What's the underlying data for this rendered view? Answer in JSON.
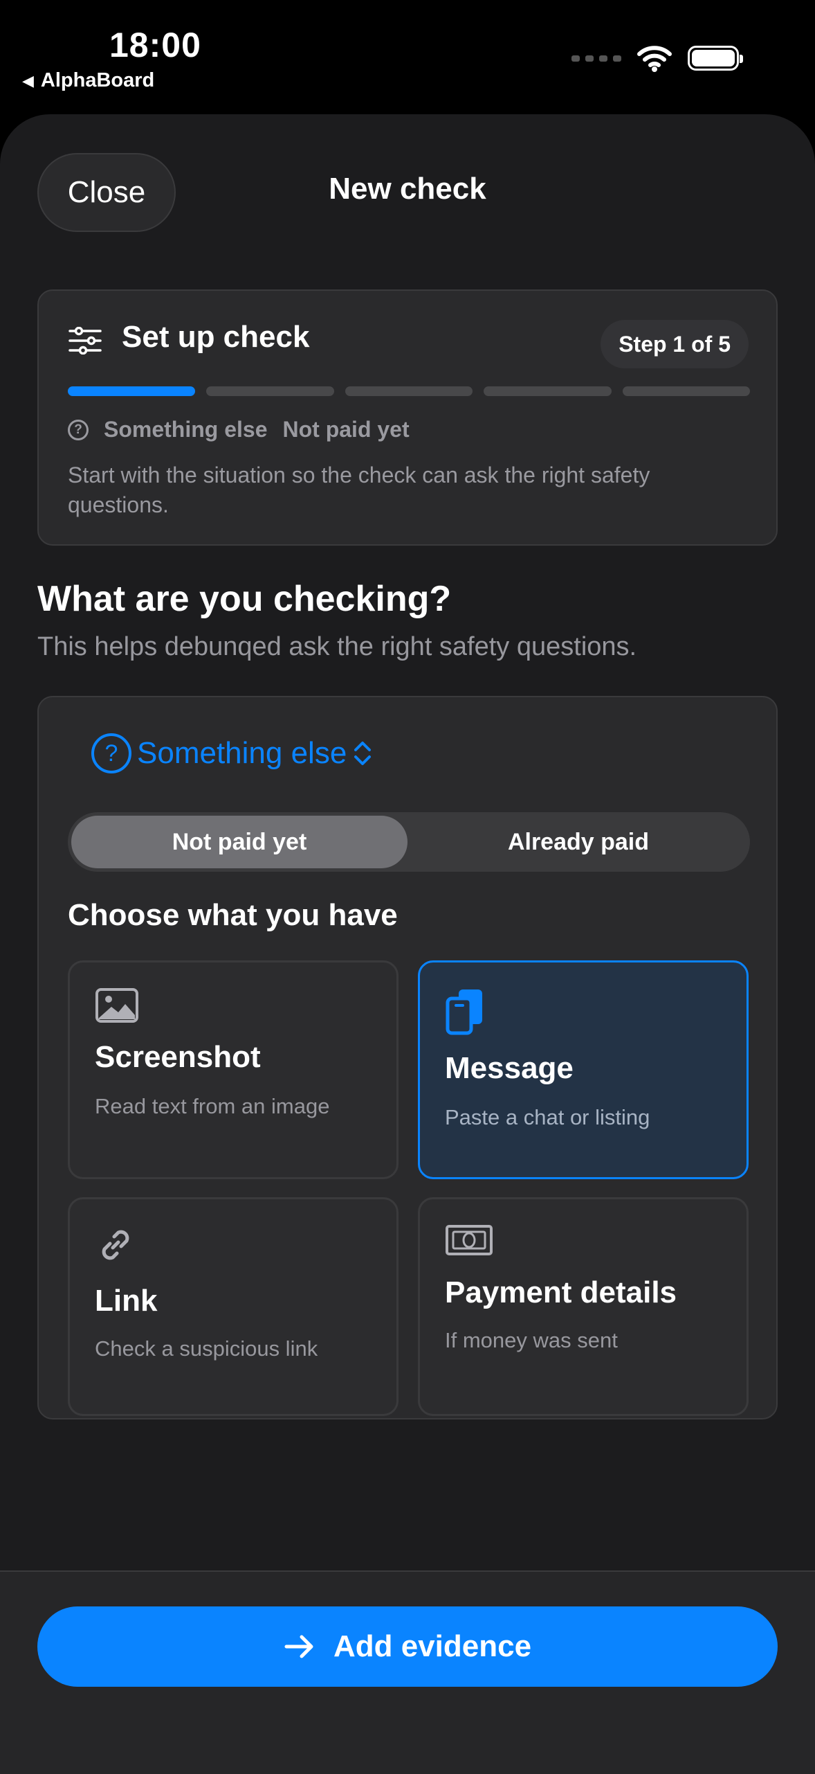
{
  "status_bar": {
    "time": "18:00",
    "back_app": "AlphaBoard"
  },
  "header": {
    "close_label": "Close",
    "title": "New check"
  },
  "setup": {
    "title": "Set up check",
    "step": "Step 1 of 5",
    "progress_current": 1,
    "progress_total": 5,
    "crumb_category": "Something else",
    "crumb_status": "Not paid yet",
    "description": "Start with the situation so the check can ask the right safety questions."
  },
  "question": {
    "title": "What are you checking?",
    "subtitle": "This helps debunqed ask the right safety questions."
  },
  "selector": {
    "value": "Something else",
    "icon": "question-circle-icon"
  },
  "segmented": {
    "left": "Not paid yet",
    "right": "Already paid",
    "selected": "left"
  },
  "choose": {
    "title": "Choose what you have",
    "options": [
      {
        "title": "Screenshot",
        "desc": "Read text from an image",
        "icon": "image-icon",
        "selected": false
      },
      {
        "title": "Message",
        "desc": "Paste a chat or listing",
        "icon": "message-icon",
        "selected": true
      },
      {
        "title": "Link",
        "desc": "Check a suspicious link",
        "icon": "link-icon",
        "selected": false
      },
      {
        "title": "Payment details",
        "desc": "If money was sent",
        "icon": "banknote-icon",
        "selected": false
      }
    ]
  },
  "cta": {
    "label": "Add evidence"
  },
  "colors": {
    "accent": "#0a84ff",
    "background": "#1c1c1e",
    "card": "#2a2a2c"
  }
}
